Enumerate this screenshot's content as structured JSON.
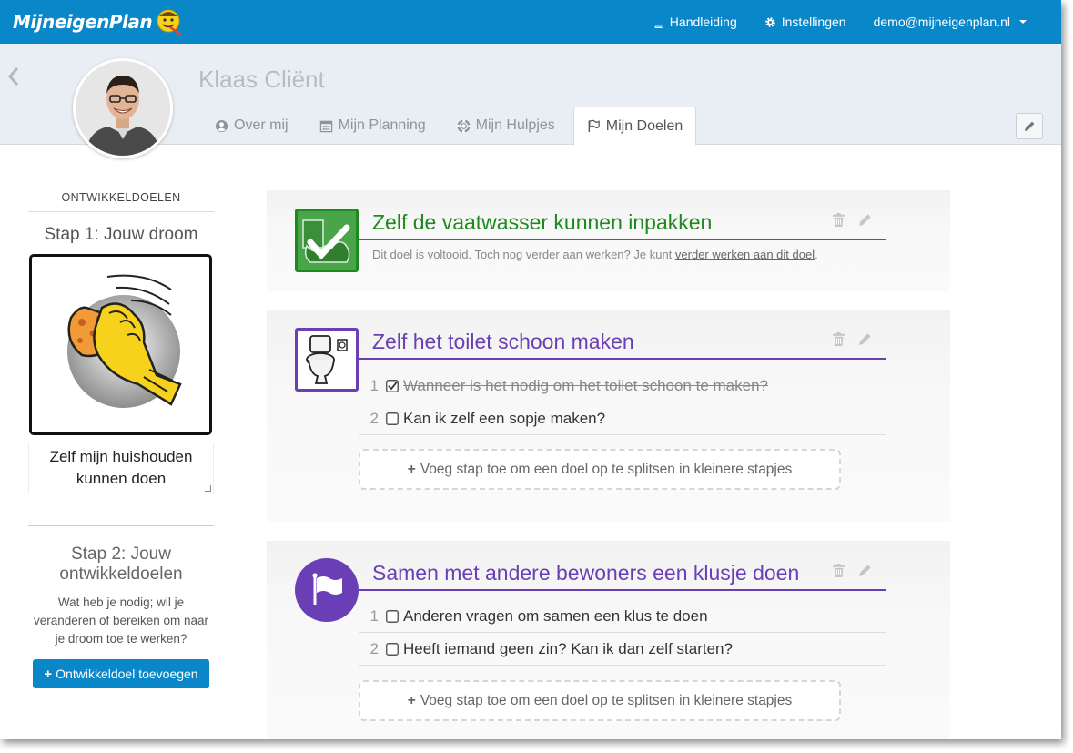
{
  "app": {
    "brand": "MijneigenPlan"
  },
  "topnav": {
    "manual_label": "Handleiding",
    "settings_label": "Instellingen",
    "user_label": "demo@mijneigenplan.nl"
  },
  "profile": {
    "client_name": "Klaas Cliënt",
    "tabs": [
      {
        "label": "Over mij",
        "icon": "user-circle-icon"
      },
      {
        "label": "Mijn Planning",
        "icon": "calendar-icon"
      },
      {
        "label": "Mijn Hulpjes",
        "icon": "lifebuoy-icon"
      },
      {
        "label": "Mijn Doelen",
        "icon": "flag-icon",
        "active": true
      }
    ]
  },
  "sidebar": {
    "heading": "ONTWIKKELDOELEN",
    "step1_title": "Stap 1: Jouw droom",
    "dream_text": "Zelf mijn huishouden kunnen doen",
    "step2_title": "Stap 2: Jouw ontwikkeldoelen",
    "step2_desc": "Wat heb je nodig; wil je veranderen of bereiken om naar je droom toe te werken?",
    "add_goal_label": "Ontwikkeldoel toevoegen"
  },
  "goals": [
    {
      "title": "Zelf de vaatwasser kunnen inpakken",
      "color": "#1e8a1e",
      "completed": true,
      "note_prefix": "Dit doel is voltooid. Toch nog verder aan werken? Je kunt ",
      "note_link": "verder werken aan dit doel",
      "note_suffix": "."
    },
    {
      "title": "Zelf het toilet schoon maken",
      "color": "#6a3fb5",
      "steps": [
        {
          "num": "1",
          "text": "Wanneer is het nodig om het toilet schoon te maken?",
          "done": true
        },
        {
          "num": "2",
          "text": "Kan ik zelf een sopje maken?",
          "done": false
        }
      ],
      "add_step_label": "Voeg stap toe om een doel op te splitsen in kleinere stapjes"
    },
    {
      "title": "Samen met andere bewoners een klusje doen",
      "color": "#6a3fb5",
      "steps": [
        {
          "num": "1",
          "text": "Anderen vragen om samen een klus te doen",
          "done": false
        },
        {
          "num": "2",
          "text": "Heeft iemand geen zin? Kan ik dan zelf starten?",
          "done": false
        }
      ],
      "add_step_label": "Voeg stap toe om een doel op te splitsen in kleinere stapjes"
    }
  ],
  "colors": {
    "nav": "#0a87c9",
    "primary_button": "#0a87c9",
    "completed_goal": "#1e8a1e",
    "active_goal": "#6a3fb5"
  }
}
